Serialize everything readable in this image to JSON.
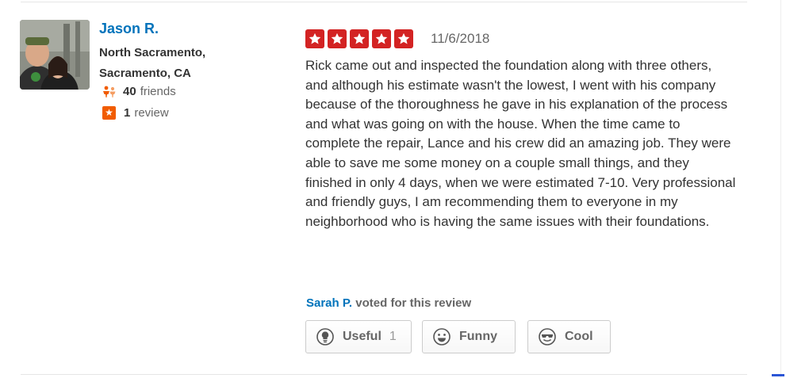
{
  "user": {
    "name": "Jason R.",
    "location": "North Sacramento, Sacramento, CA",
    "friends_count": "40",
    "friends_label": "friends",
    "reviews_count": "1",
    "reviews_label": "review"
  },
  "review": {
    "rating": 5,
    "rating_max": 5,
    "date": "11/6/2018",
    "text": "Rick came out and inspected the foundation along with three others, and although his estimate wasn't the lowest, I went with his company because of the thoroughness he gave in his explanation of the process and what was going on with the house. When the time came to complete the repair, Lance and his crew did an amazing job. They were able to save me some money on a couple small things, and they finished in only 4 days, when we were estimated 7-10. Very professional and friendly guys, I am recommending them to everyone in my neighborhood who is having the same issues with their foundations."
  },
  "votes": {
    "voter_name": "Sarah P.",
    "voted_text": "voted for this review",
    "useful_label": "Useful",
    "useful_count": "1",
    "funny_label": "Funny",
    "cool_label": "Cool"
  },
  "icons": {
    "friends": "friends-icon",
    "review": "review-star-icon",
    "star": "star-icon",
    "useful": "lightbulb-icon",
    "funny": "smiley-icon",
    "cool": "sunglasses-icon"
  },
  "colors": {
    "link_blue": "#0073bb",
    "star_red": "#d32323",
    "review_orange": "#f15c00",
    "friends_orange": "#f15c00"
  }
}
